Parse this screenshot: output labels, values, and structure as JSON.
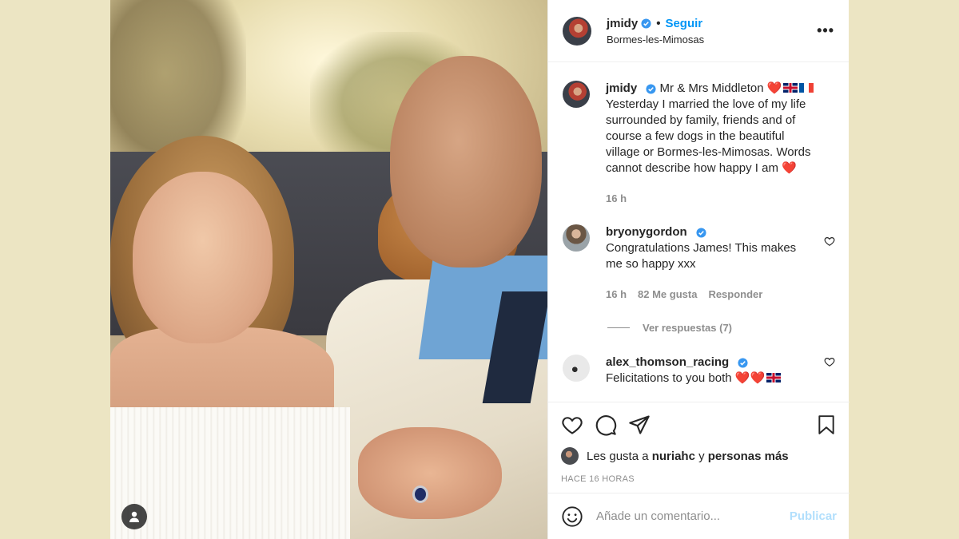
{
  "post": {
    "username": "jmidy",
    "follow_label": "Seguir",
    "separator": "•",
    "location": "Bormes-les-Mimosas",
    "more_label": "•••"
  },
  "caption": {
    "username": "jmidy",
    "text_line1": "Mr & Mrs Middleton",
    "text_body": "Yesterday I married the love of my life surrounded by family, friends and of course a few dogs in the beautiful village or Bormes-les-Mimosas. Words cannot describe how happy I am",
    "heart": "❤️",
    "time": "16 h"
  },
  "comments": [
    {
      "username": "bryonygordon",
      "text": "Congratulations James! This makes me so happy xxx",
      "time": "16 h",
      "likes": "82 Me gusta",
      "reply_label": "Responder",
      "view_replies": "Ver respuestas (7)"
    },
    {
      "username": "alex_thomson_racing",
      "text": "Felicitations to you both",
      "hearts": "❤️❤️"
    }
  ],
  "likes": {
    "prefix": "Les gusta a",
    "user": "nuriahc",
    "connector": "y",
    "others": "personas más"
  },
  "timestamp": "HACE 16 HORAS",
  "add_comment": {
    "placeholder": "Añade un comentario...",
    "publish_label": "Publicar"
  },
  "colors": {
    "background": "#ece5c3",
    "accent": "#0095f6",
    "publish_disabled": "#b2dffc",
    "muted": "#8e8e8e"
  },
  "icons": [
    "verified-badge-icon",
    "more-options-icon",
    "user-tag-icon",
    "heart-icon",
    "comment-icon",
    "share-icon",
    "bookmark-icon",
    "emoji-icon",
    "uk-flag-icon",
    "france-flag-icon"
  ]
}
